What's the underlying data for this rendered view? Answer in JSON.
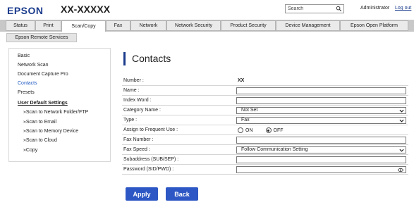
{
  "header": {
    "brand": "EPSON",
    "model": "XX-XXXXX",
    "search_placeholder": "Search",
    "user": "Administrator",
    "logout": "Log out"
  },
  "tabs": [
    "Status",
    "Print",
    "Scan/Copy",
    "Fax",
    "Network",
    "Network Security",
    "Product Security",
    "Device Management",
    "Epson Open Platform"
  ],
  "active_tab": "Scan/Copy",
  "subtabs": [
    "Epson Remote Services"
  ],
  "sidebar": {
    "items": [
      "Basic",
      "Network Scan",
      "Document Capture Pro",
      "Contacts",
      "Presets"
    ],
    "section": "User Default Settings",
    "subitems": [
      "»Scan to Network Folder/FTP",
      "»Scan to Email",
      "»Scan to Memory Device",
      "»Scan to Cloud",
      "»Copy"
    ]
  },
  "page": {
    "title": "Contacts",
    "rows": {
      "number": {
        "label": "Number :",
        "value": "XX"
      },
      "name": {
        "label": "Name :",
        "value": ""
      },
      "index_word": {
        "label": "Index Word :",
        "value": ""
      },
      "category": {
        "label": "Category Name :",
        "value": "Not Set"
      },
      "type": {
        "label": "Type :",
        "value": "Fax"
      },
      "frequent": {
        "label": "Assign to Frequent Use :",
        "on_label": "ON",
        "off_label": "OFF",
        "selected": "OFF"
      },
      "fax_number": {
        "label": "Fax Number :",
        "value": ""
      },
      "fax_speed": {
        "label": "Fax Speed :",
        "value": "Follow Communication Setting"
      },
      "subaddress": {
        "label": "Subaddress (SUB/SEP) :",
        "value": ""
      },
      "password": {
        "label": "Password (SID/PWD) :",
        "value": ""
      }
    },
    "buttons": {
      "apply": "Apply",
      "back": "Back"
    }
  },
  "colors": {
    "brand": "#1a3b8c",
    "button": "#2d57c4",
    "tabbar": "#c8c8c8",
    "link": "#1a55c0"
  }
}
